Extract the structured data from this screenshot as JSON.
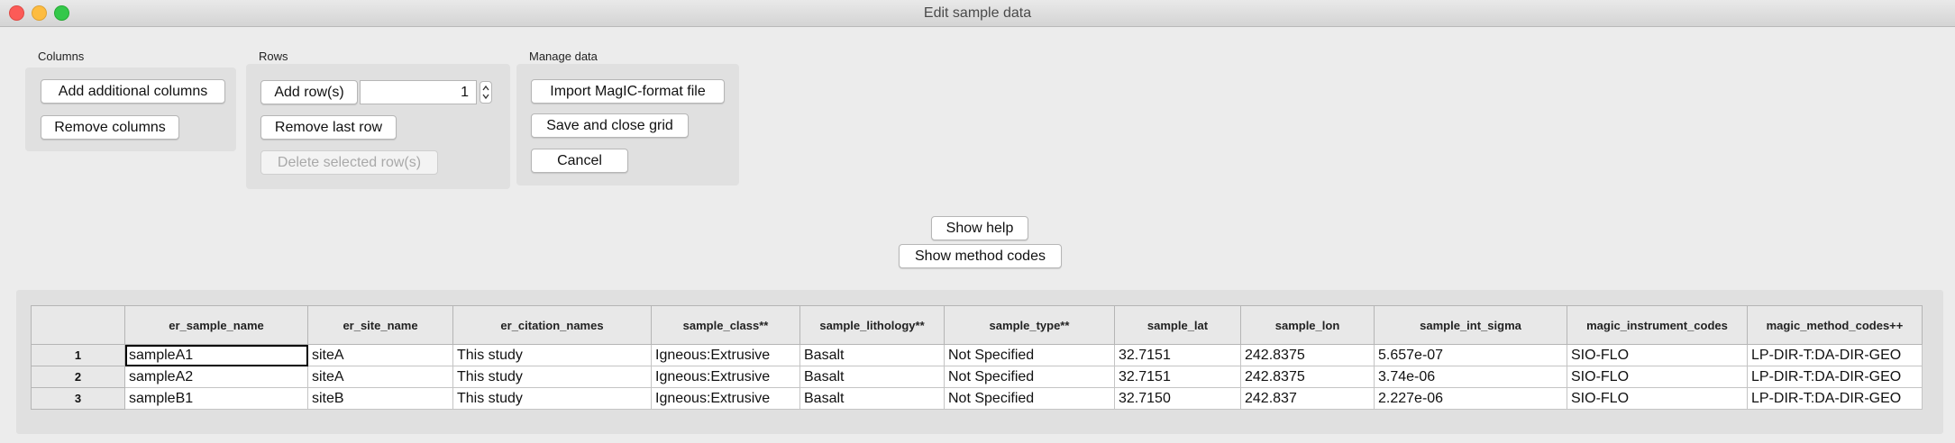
{
  "window": {
    "title": "Edit sample data"
  },
  "columns_group": {
    "label": "Columns",
    "add_label": "Add additional columns",
    "remove_label": "Remove columns"
  },
  "rows_group": {
    "label": "Rows",
    "add_label": "Add row(s)",
    "row_count": "1",
    "remove_last_label": "Remove last row",
    "delete_selected_label": "Delete selected row(s)"
  },
  "manage_group": {
    "label": "Manage data",
    "import_label": "Import MagIC-format file",
    "save_label": "Save and close grid",
    "cancel_label": "Cancel"
  },
  "help": {
    "show_help_label": "Show help",
    "show_method_codes_label": "Show method codes"
  },
  "grid": {
    "columns": [
      "er_sample_name",
      "er_site_name",
      "er_citation_names",
      "sample_class**",
      "sample_lithology**",
      "sample_type**",
      "sample_lat",
      "sample_lon",
      "sample_int_sigma",
      "magic_instrument_codes",
      "magic_method_codes++"
    ],
    "rows": [
      {
        "num": "1",
        "cells": [
          "sampleA1",
          "siteA",
          "This study",
          "Igneous:Extrusive",
          "Basalt",
          "Not Specified",
          "32.7151",
          "242.8375",
          "5.657e-07",
          "SIO-FLO",
          "LP-DIR-T:DA-DIR-GEO"
        ]
      },
      {
        "num": "2",
        "cells": [
          "sampleA2",
          "siteA",
          "This study",
          "Igneous:Extrusive",
          "Basalt",
          "Not Specified",
          "32.7151",
          "242.8375",
          "3.74e-06",
          "SIO-FLO",
          "LP-DIR-T:DA-DIR-GEO"
        ]
      },
      {
        "num": "3",
        "cells": [
          "sampleB1",
          "siteB",
          "This study",
          "Igneous:Extrusive",
          "Basalt",
          "Not Specified",
          "32.7150",
          "242.837",
          "2.227e-06",
          "SIO-FLO",
          "LP-DIR-T:DA-DIR-GEO"
        ]
      }
    ]
  }
}
